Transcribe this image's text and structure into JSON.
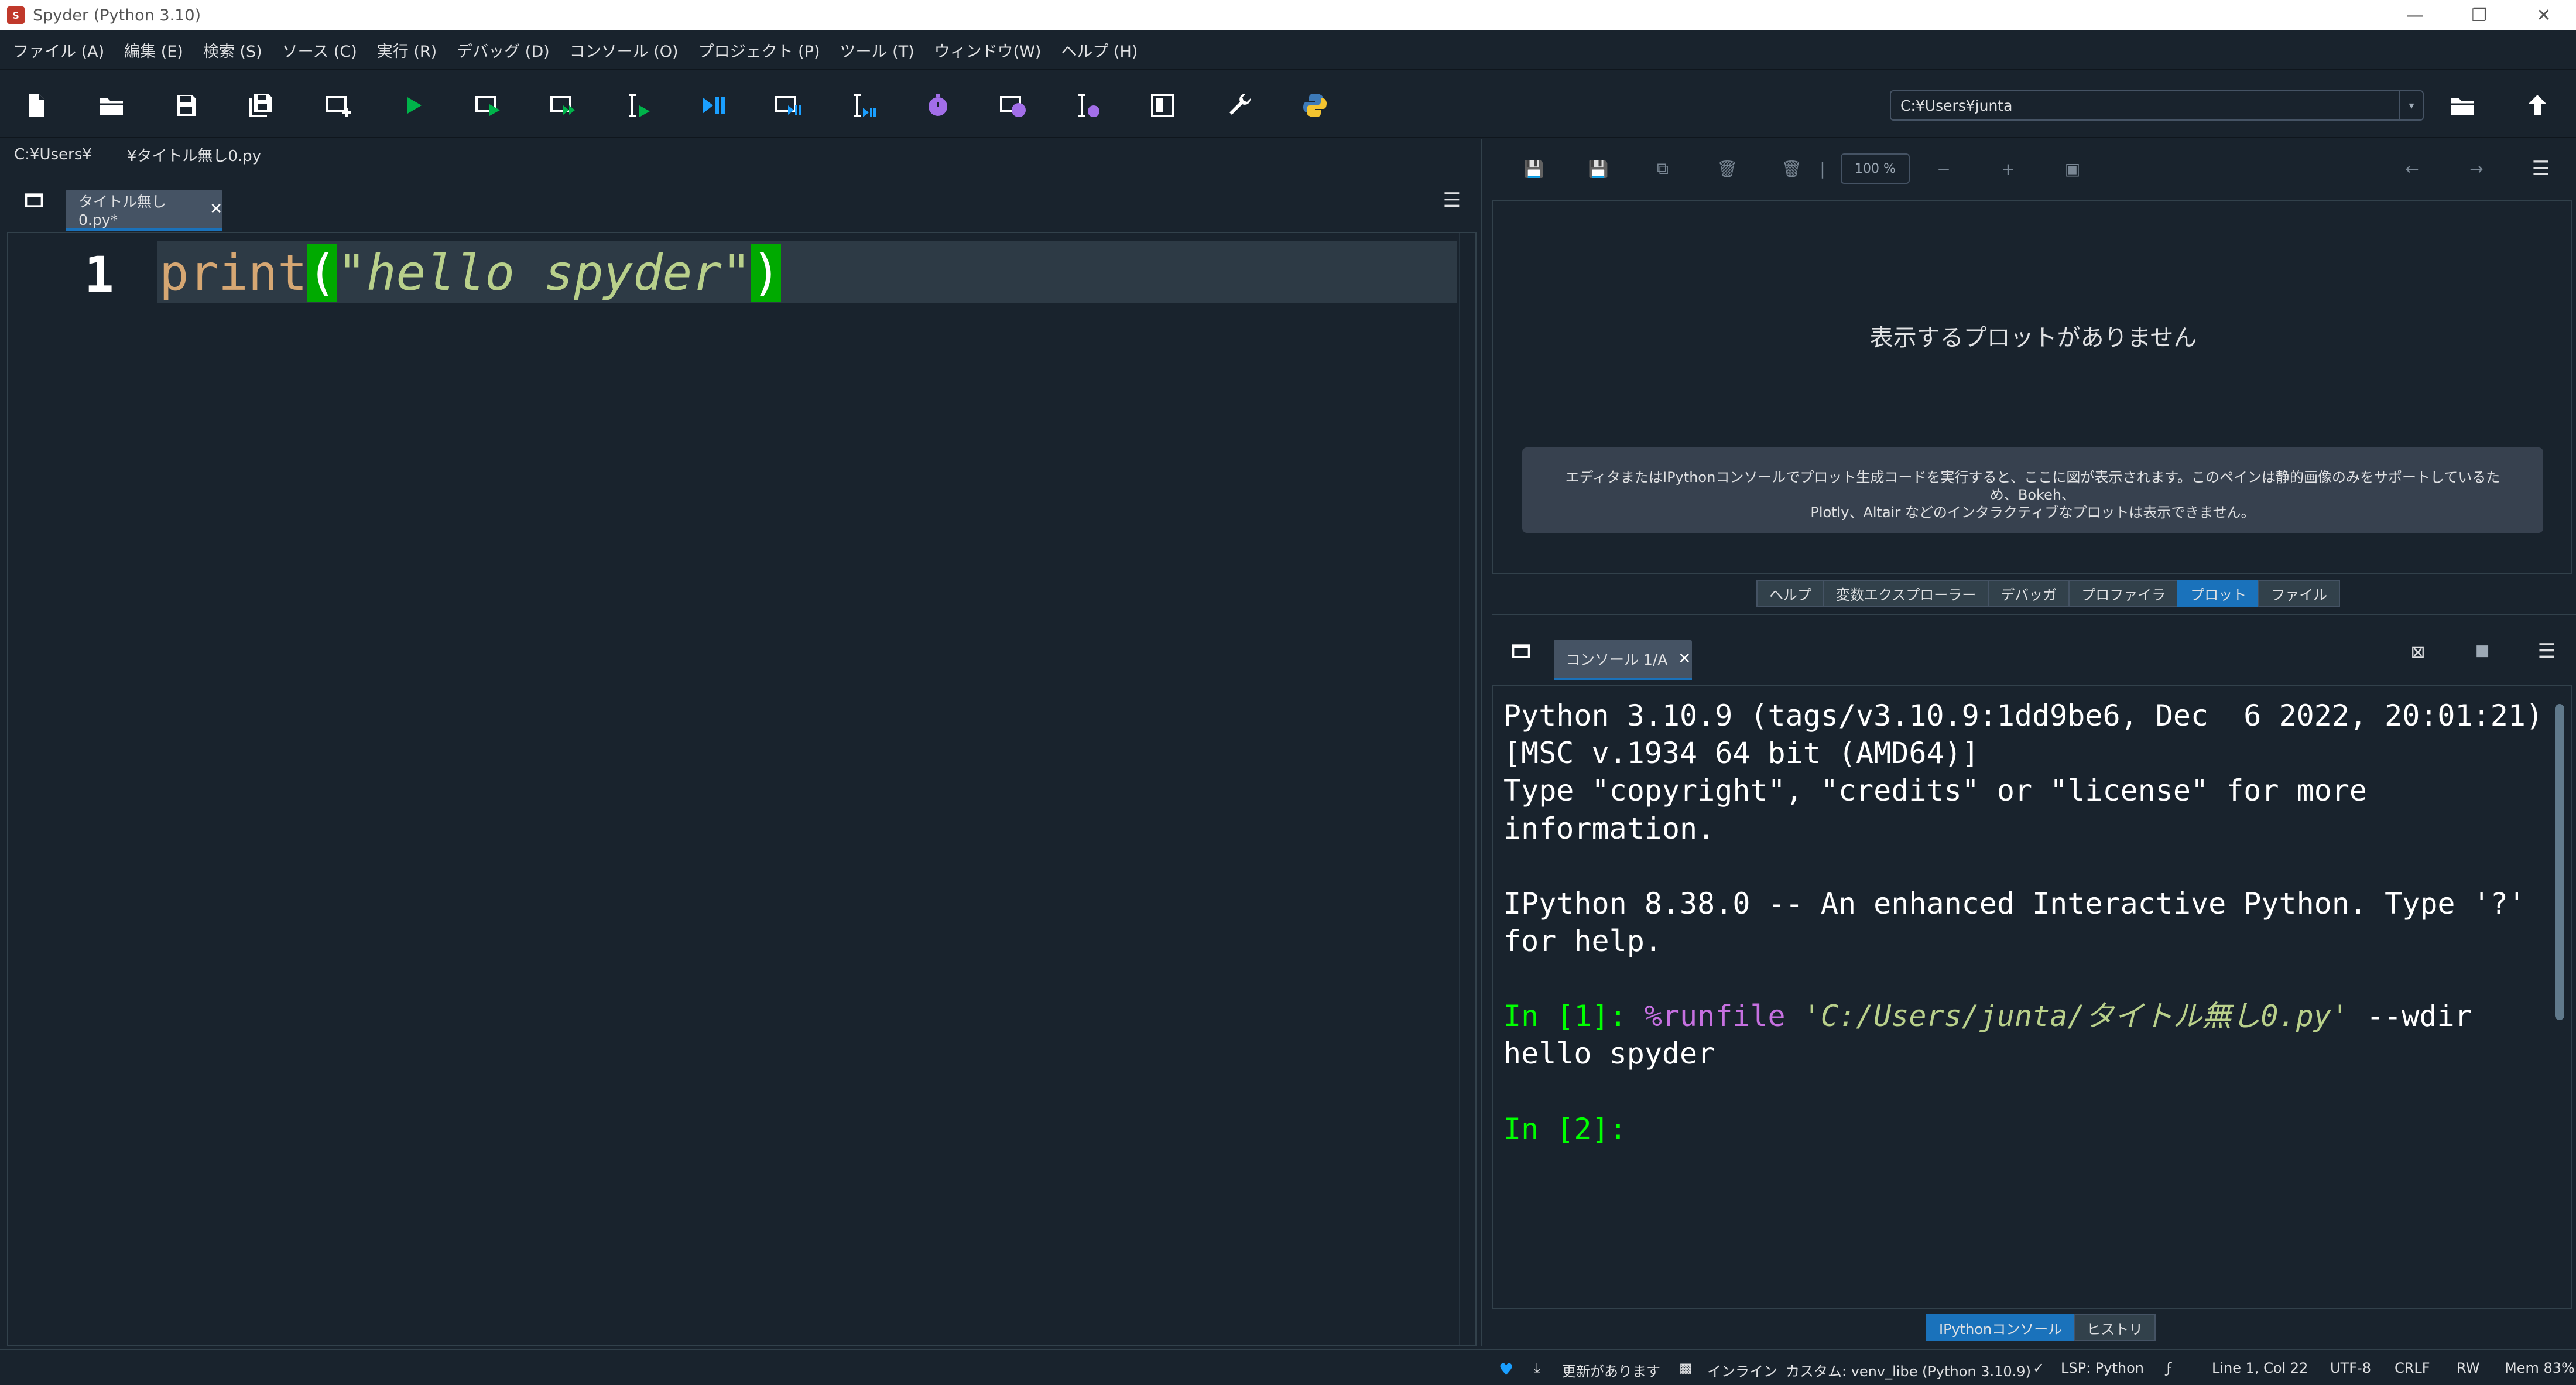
{
  "window": {
    "title": "Spyder (Python 3.10)"
  },
  "menubar": {
    "items": [
      "ファイル (A)",
      "編集 (E)",
      "検索 (S)",
      "ソース (C)",
      "実行 (R)",
      "デバッグ (D)",
      "コンソール (O)",
      "プロジェクト (P)",
      "ツール (T)",
      "ウィンドウ(W)",
      "ヘルプ (H)"
    ]
  },
  "toolbar": {
    "icons": [
      "new-file-icon",
      "open-folder-icon",
      "save-icon",
      "save-all-icon",
      "new-cell-icon",
      "run-icon",
      "run-cell-icon",
      "run-cell-advance-icon",
      "run-selection-icon",
      "debug-icon",
      "debug-cell-icon",
      "debug-selection-icon",
      "profile-icon",
      "profile-cell-icon",
      "profile-selection-icon",
      "maximize-pane-icon",
      "preferences-icon",
      "python-icon"
    ],
    "working_directory": "C:¥Users¥junta"
  },
  "breadcrumb": {
    "path_start": "C:¥Users¥",
    "path_end": "¥タイトル無し0.py"
  },
  "editor": {
    "tab_label": "タイトル無し0.py*",
    "line_number": "1",
    "code": {
      "fn": "print",
      "open_paren": "(",
      "string": "\"hello spyder\"",
      "close_paren": ")"
    }
  },
  "plots": {
    "zoom": "100 %",
    "empty_title": "表示するプロットがありません",
    "info_line1": "エディタまたはIPythonコンソールでプロット生成コードを実行すると、ここに図が表示されます。このペインは静的画像のみをサポートしているため、Bokeh、",
    "info_line2": "Plotly、Altair などのインタラクティブなプロットは表示できません。",
    "tabs": [
      "ヘルプ",
      "変数エクスプローラー",
      "デバッガ",
      "プロファイラ",
      "プロット",
      "ファイル"
    ],
    "active_tab": "プロット"
  },
  "console": {
    "tab_label": "コンソール 1/A",
    "banner_line1": "Python 3.10.9 (tags/v3.10.9:1dd9be6, Dec  6 2022, 20:01:21)",
    "banner_line2": "[MSC v.1934 64 bit (AMD64)]",
    "banner_line3": "Type \"copyright\", \"credits\" or \"license\" for more",
    "banner_line4": "information.",
    "ipython_line1": "IPython 8.38.0 -- An enhanced Interactive Python. Type '?'",
    "ipython_line2": "for help.",
    "in1_prompt": "In [1]:",
    "in1_magic": "%runfile",
    "in1_path": "'C:/Users/junta/タイトル無し0.py'",
    "in1_rest": "--wdir",
    "output1": "hello spyder",
    "in2_prompt": "In [2]:",
    "bottom_tabs": [
      "IPythonコンソール",
      "ヒストリ"
    ],
    "active_tab": "IPythonコンソール"
  },
  "statusbar": {
    "update": "更新があります",
    "inline": "インライン",
    "env": "カスタム: venv_libe (Python 3.10.9)",
    "lsp": "LSP: Python",
    "position": "Line 1, Col 22",
    "encoding": "UTF-8",
    "eol": "CRLF",
    "mode": "RW",
    "mem": "Mem 83%"
  },
  "colors": {
    "background": "#19232d",
    "accent": "#1a72bb",
    "green_prompt": "#00ff00"
  }
}
